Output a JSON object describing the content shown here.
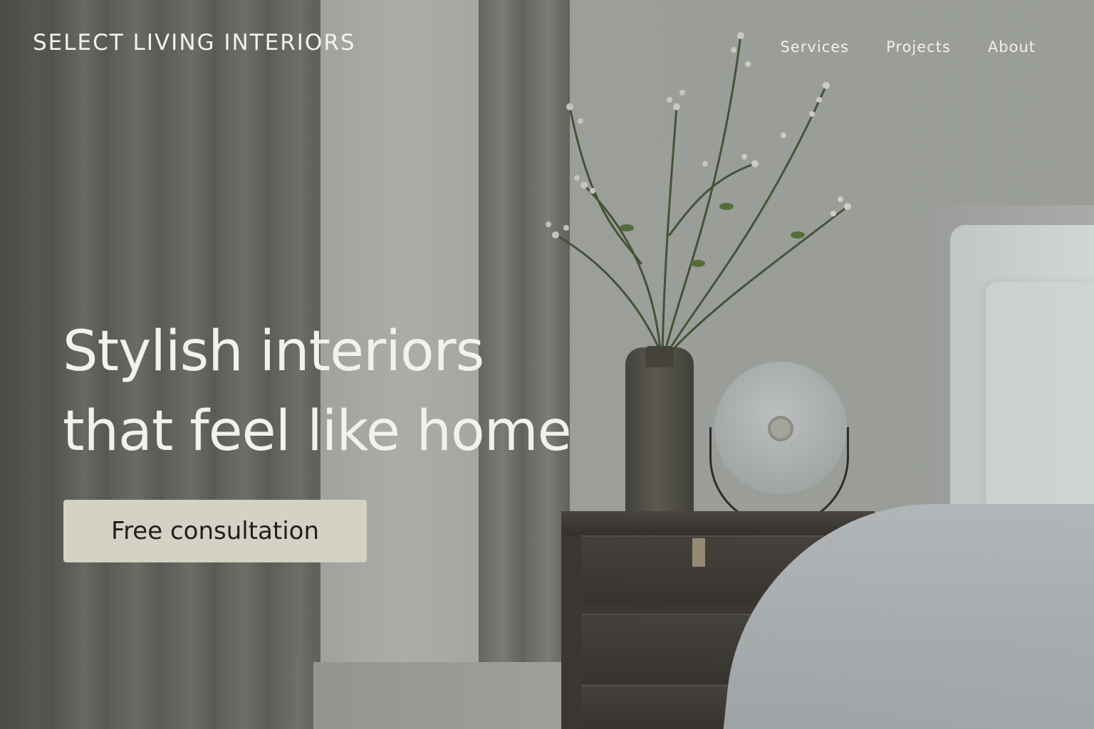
{
  "header": {
    "brand": "SELECT LIVING INTERIORS",
    "nav": [
      {
        "label": "Services"
      },
      {
        "label": "Projects"
      },
      {
        "label": "About"
      }
    ]
  },
  "hero": {
    "headline_line1": "Stylish interiors",
    "headline_line2": "that feel like home",
    "cta_label": "Free consultation",
    "cta_color": "#d4d1c5",
    "text_color": "#f2f1ec"
  }
}
